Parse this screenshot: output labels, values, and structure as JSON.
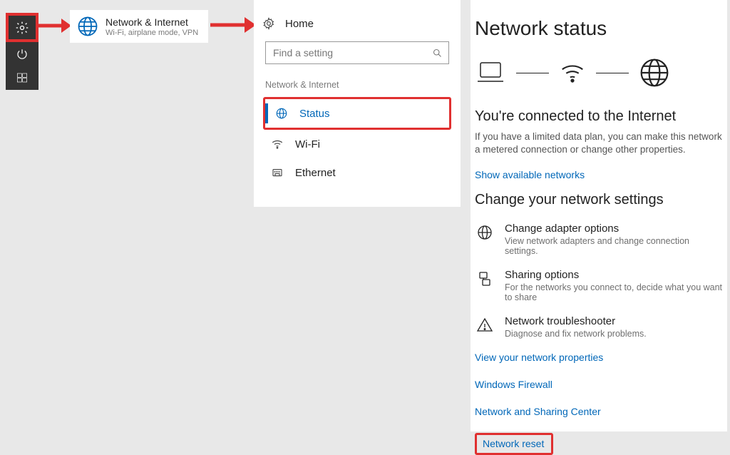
{
  "start": {
    "icons": [
      "gear",
      "power",
      "windows"
    ]
  },
  "tile": {
    "title": "Network & Internet",
    "subtitle": "Wi-Fi, airplane mode, VPN"
  },
  "settings": {
    "home_label": "Home",
    "search_placeholder": "Find a setting",
    "section_label": "Network & Internet",
    "nav": [
      {
        "label": "Status",
        "icon": "globe",
        "active": true
      },
      {
        "label": "Wi-Fi",
        "icon": "wifi",
        "active": false
      },
      {
        "label": "Ethernet",
        "icon": "ethernet",
        "active": false
      }
    ]
  },
  "main": {
    "title": "Network status",
    "connected_heading": "You're connected to the Internet",
    "connected_body": "If you have a limited data plan, you can make this network a metered connection or change other properties.",
    "show_networks_link": "Show available networks",
    "change_heading": "Change your network settings",
    "items": [
      {
        "title": "Change adapter options",
        "desc": "View network adapters and change connection settings."
      },
      {
        "title": "Sharing options",
        "desc": "For the networks you connect to, decide what you want to share"
      },
      {
        "title": "Network troubleshooter",
        "desc": "Diagnose and fix network problems."
      }
    ],
    "links": [
      "View your network properties",
      "Windows Firewall",
      "Network and Sharing Center"
    ],
    "reset_link": "Network reset"
  },
  "colors": {
    "accent": "#0067b8",
    "highlight": "#e03030"
  }
}
